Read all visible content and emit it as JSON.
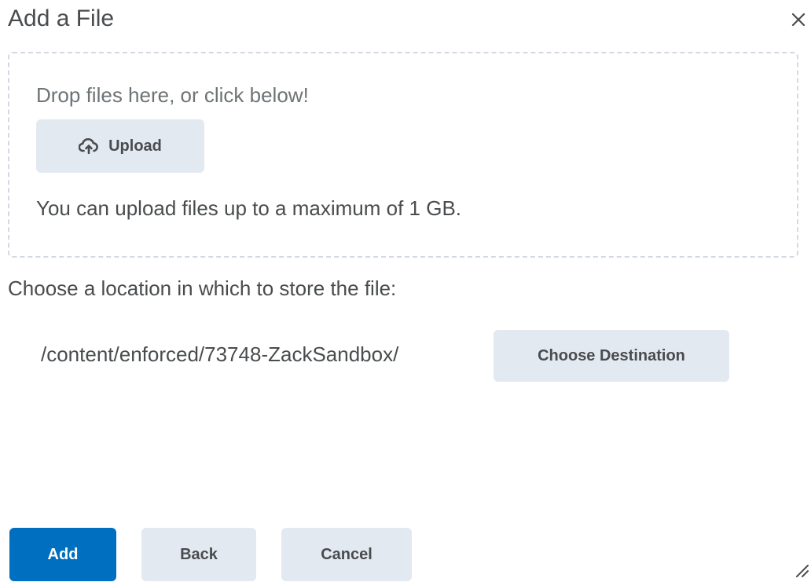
{
  "dialog": {
    "title": "Add a File",
    "close_icon": "close-icon"
  },
  "dropzone": {
    "hint": "Drop files here, or click below!",
    "upload_label": "Upload",
    "upload_icon": "cloud-upload-icon",
    "max_size_text": "You can upload files up to a maximum of 1 GB."
  },
  "location": {
    "label": "Choose a location in which to store the file:",
    "path": "/content/enforced/73748-ZackSandbox/",
    "choose_label": "Choose Destination"
  },
  "footer": {
    "add_label": "Add",
    "back_label": "Back",
    "cancel_label": "Cancel"
  },
  "colors": {
    "primary": "#006fbf",
    "secondary_bg": "#e3e9f1",
    "text": "#494c4e",
    "muted_text": "#6e7376",
    "dropzone_border": "#d3d9e3"
  }
}
